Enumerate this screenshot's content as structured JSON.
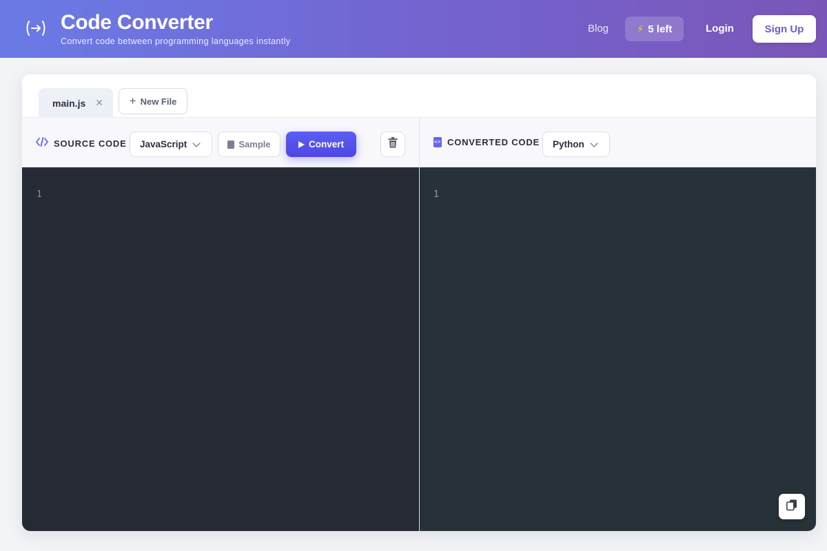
{
  "header": {
    "title": "Code Converter",
    "subtitle": "Convert code between programming languages instantly",
    "nav_blog": "Blog",
    "credits": "5 left",
    "login": "Login",
    "signup": "Sign Up"
  },
  "tabs": [
    {
      "label": "main.js",
      "active": true
    }
  ],
  "new_file_label": "New File",
  "source": {
    "section_label": "SOURCE CODE",
    "language": "JavaScript",
    "sample_label": "Sample",
    "convert_label": "Convert",
    "line_numbers": [
      "1"
    ]
  },
  "target": {
    "section_label": "CONVERTED CODE",
    "language": "Python",
    "line_numbers": [
      "1"
    ]
  },
  "colors": {
    "accent": "#4f46e5",
    "header_gradient_start": "#6a7be6",
    "header_gradient_end": "#7a56b8",
    "editor_source_bg": "#262a35",
    "editor_target_bg": "#263238"
  },
  "icons": {
    "logo": "arrow-in-brackets-icon",
    "credits": "bolt-icon",
    "tab_close": "close-icon",
    "new_file": "plus-icon",
    "source": "code-icon",
    "target": "file-code-icon",
    "sample": "doc-icon",
    "convert": "play-icon",
    "clear": "trash-icon",
    "copy": "copy-icon"
  }
}
